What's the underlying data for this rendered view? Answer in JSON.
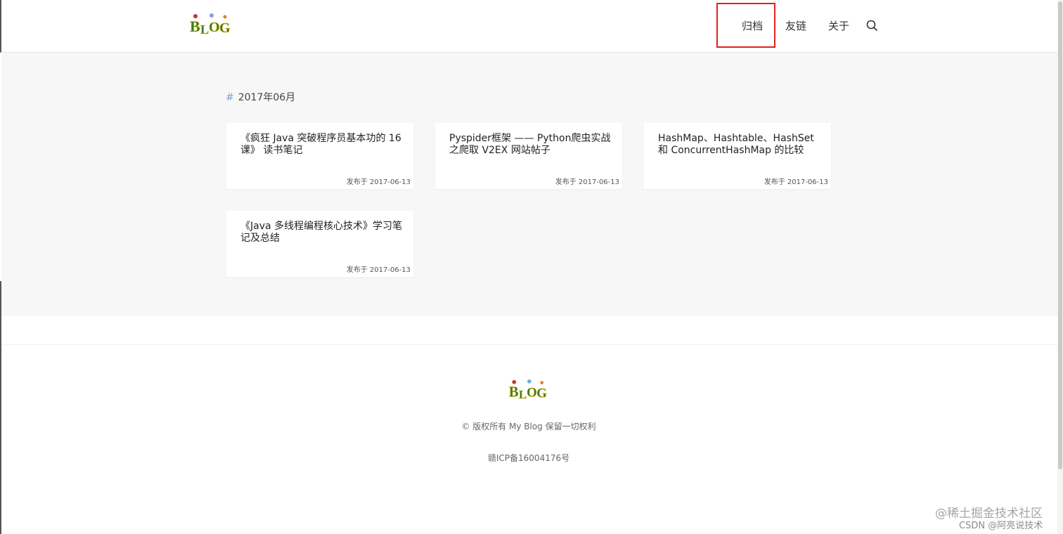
{
  "header": {
    "logo_text": "BLOG",
    "nav": [
      {
        "label": "归档"
      },
      {
        "label": "友链"
      },
      {
        "label": "关于"
      }
    ],
    "search_icon": "search-icon"
  },
  "archive": {
    "month_hash": "#",
    "month_label": "2017年06月",
    "posts": [
      {
        "title": "《疯狂 Java 突破程序员基本功的 16 课》 读书笔记",
        "date": "发布于 2017-06-13"
      },
      {
        "title": "Pyspider框架 —— Python爬虫实战之爬取 V2EX 网站帖子",
        "date": "发布于 2017-06-13"
      },
      {
        "title": "HashMap、Hashtable、HashSet 和 ConcurrentHashMap 的比较",
        "date": "发布于 2017-06-13"
      },
      {
        "title": "《Java 多线程编程核心技术》学习笔记及总结",
        "date": "发布于 2017-06-13"
      }
    ]
  },
  "footer": {
    "logo_text": "BLOG",
    "copyright": "© 版权所有 My Blog 保留一切权利",
    "icp": "赣ICP备16004176号"
  },
  "watermark": {
    "line1": "@稀土掘金技术社区",
    "line2": "CSDN @阿亮说技术"
  },
  "colors": {
    "highlight": "#e02020",
    "hash": "#7ba6d9",
    "logo_green": "#3d7a1e",
    "logo_yellow": "#d9b51a"
  }
}
